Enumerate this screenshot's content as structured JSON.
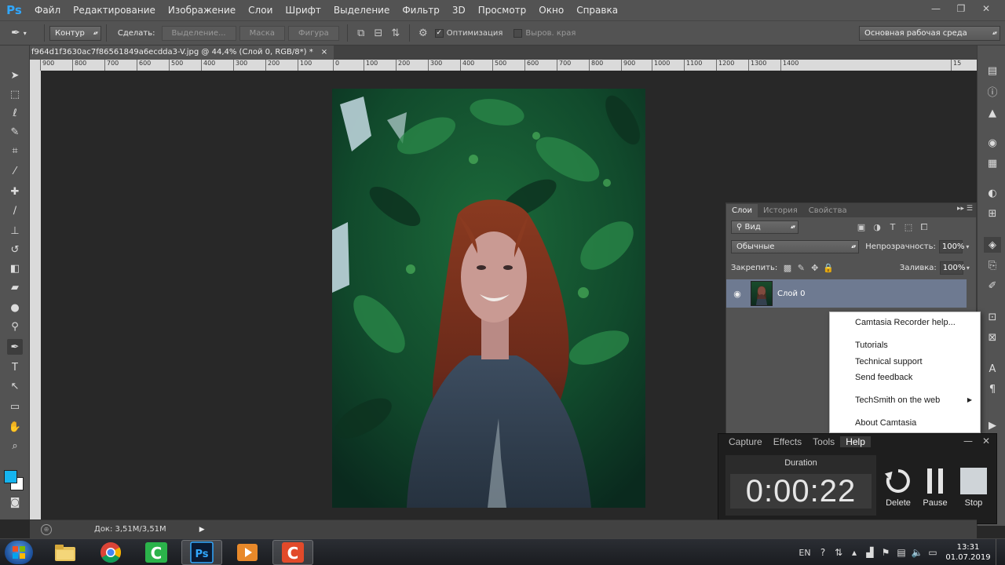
{
  "photoshop": {
    "logo": "Ps",
    "menu": [
      "Файл",
      "Редактирование",
      "Изображение",
      "Слои",
      "Шрифт",
      "Выделение",
      "Фильтр",
      "3D",
      "Просмотр",
      "Окно",
      "Справка"
    ],
    "window_controls": {
      "minimize": "—",
      "restore": "❐",
      "close": "✕"
    },
    "options": {
      "tool_icon": "pen-icon",
      "mode_select": "Контур",
      "make_label": "Сделать:",
      "selection_btn": "Выделение...",
      "mask_btn": "Маска",
      "shape_btn": "Фигура",
      "optimize_label": "Оптимизация",
      "optimize_checked": true,
      "align_edges_label": "Выров. края",
      "align_edges_checked": false,
      "workspace_select": "Основная рабочая среда"
    },
    "document_tab": {
      "title": "f964d1f3630ac7f86561849a6ecdda3-V.jpg @ 44,4% (Слой 0, RGB/8*) *",
      "close": "×"
    },
    "ruler_ticks": [
      "900",
      "800",
      "700",
      "600",
      "500",
      "400",
      "300",
      "200",
      "100",
      "0",
      "100",
      "200",
      "300",
      "400",
      "500",
      "600",
      "700",
      "800",
      "900",
      "1000",
      "1100",
      "1200",
      "1300",
      "1400",
      "15"
    ],
    "status": {
      "doc_size": "Док: 3,51M/3,51M",
      "arrow": "▶"
    }
  },
  "layers_panel": {
    "tabs": [
      "Слои",
      "История",
      "Свойства"
    ],
    "active_tab": "Слои",
    "filter_select": "Вид",
    "blend_mode": "Обычные",
    "opacity_label": "Непрозрачность:",
    "opacity_value": "100%",
    "lock_label": "Закрепить:",
    "fill_label": "Заливка:",
    "fill_value": "100%",
    "layers": [
      {
        "name": "Слой 0",
        "visible": true
      }
    ]
  },
  "camtasia_help_menu": {
    "items": [
      "Camtasia Recorder help...",
      "Tutorials",
      "Technical support",
      "Send feedback",
      "TechSmith on the web",
      "About Camtasia"
    ],
    "submenu_item": "TechSmith on the web"
  },
  "camtasia_recorder": {
    "menu": [
      "Capture",
      "Effects",
      "Tools",
      "Help"
    ],
    "hovered_menu": "Help",
    "duration_label": "Duration",
    "duration": "0:00:22",
    "buttons": {
      "delete": "Delete",
      "pause": "Pause",
      "stop": "Stop"
    }
  },
  "taskbar": {
    "language": "EN",
    "time": "13:31",
    "date": "01.07.2019"
  },
  "colors": {
    "foreground": "#15b4ef",
    "background": "#ffffff",
    "ps_accent": "#31a8ff"
  }
}
